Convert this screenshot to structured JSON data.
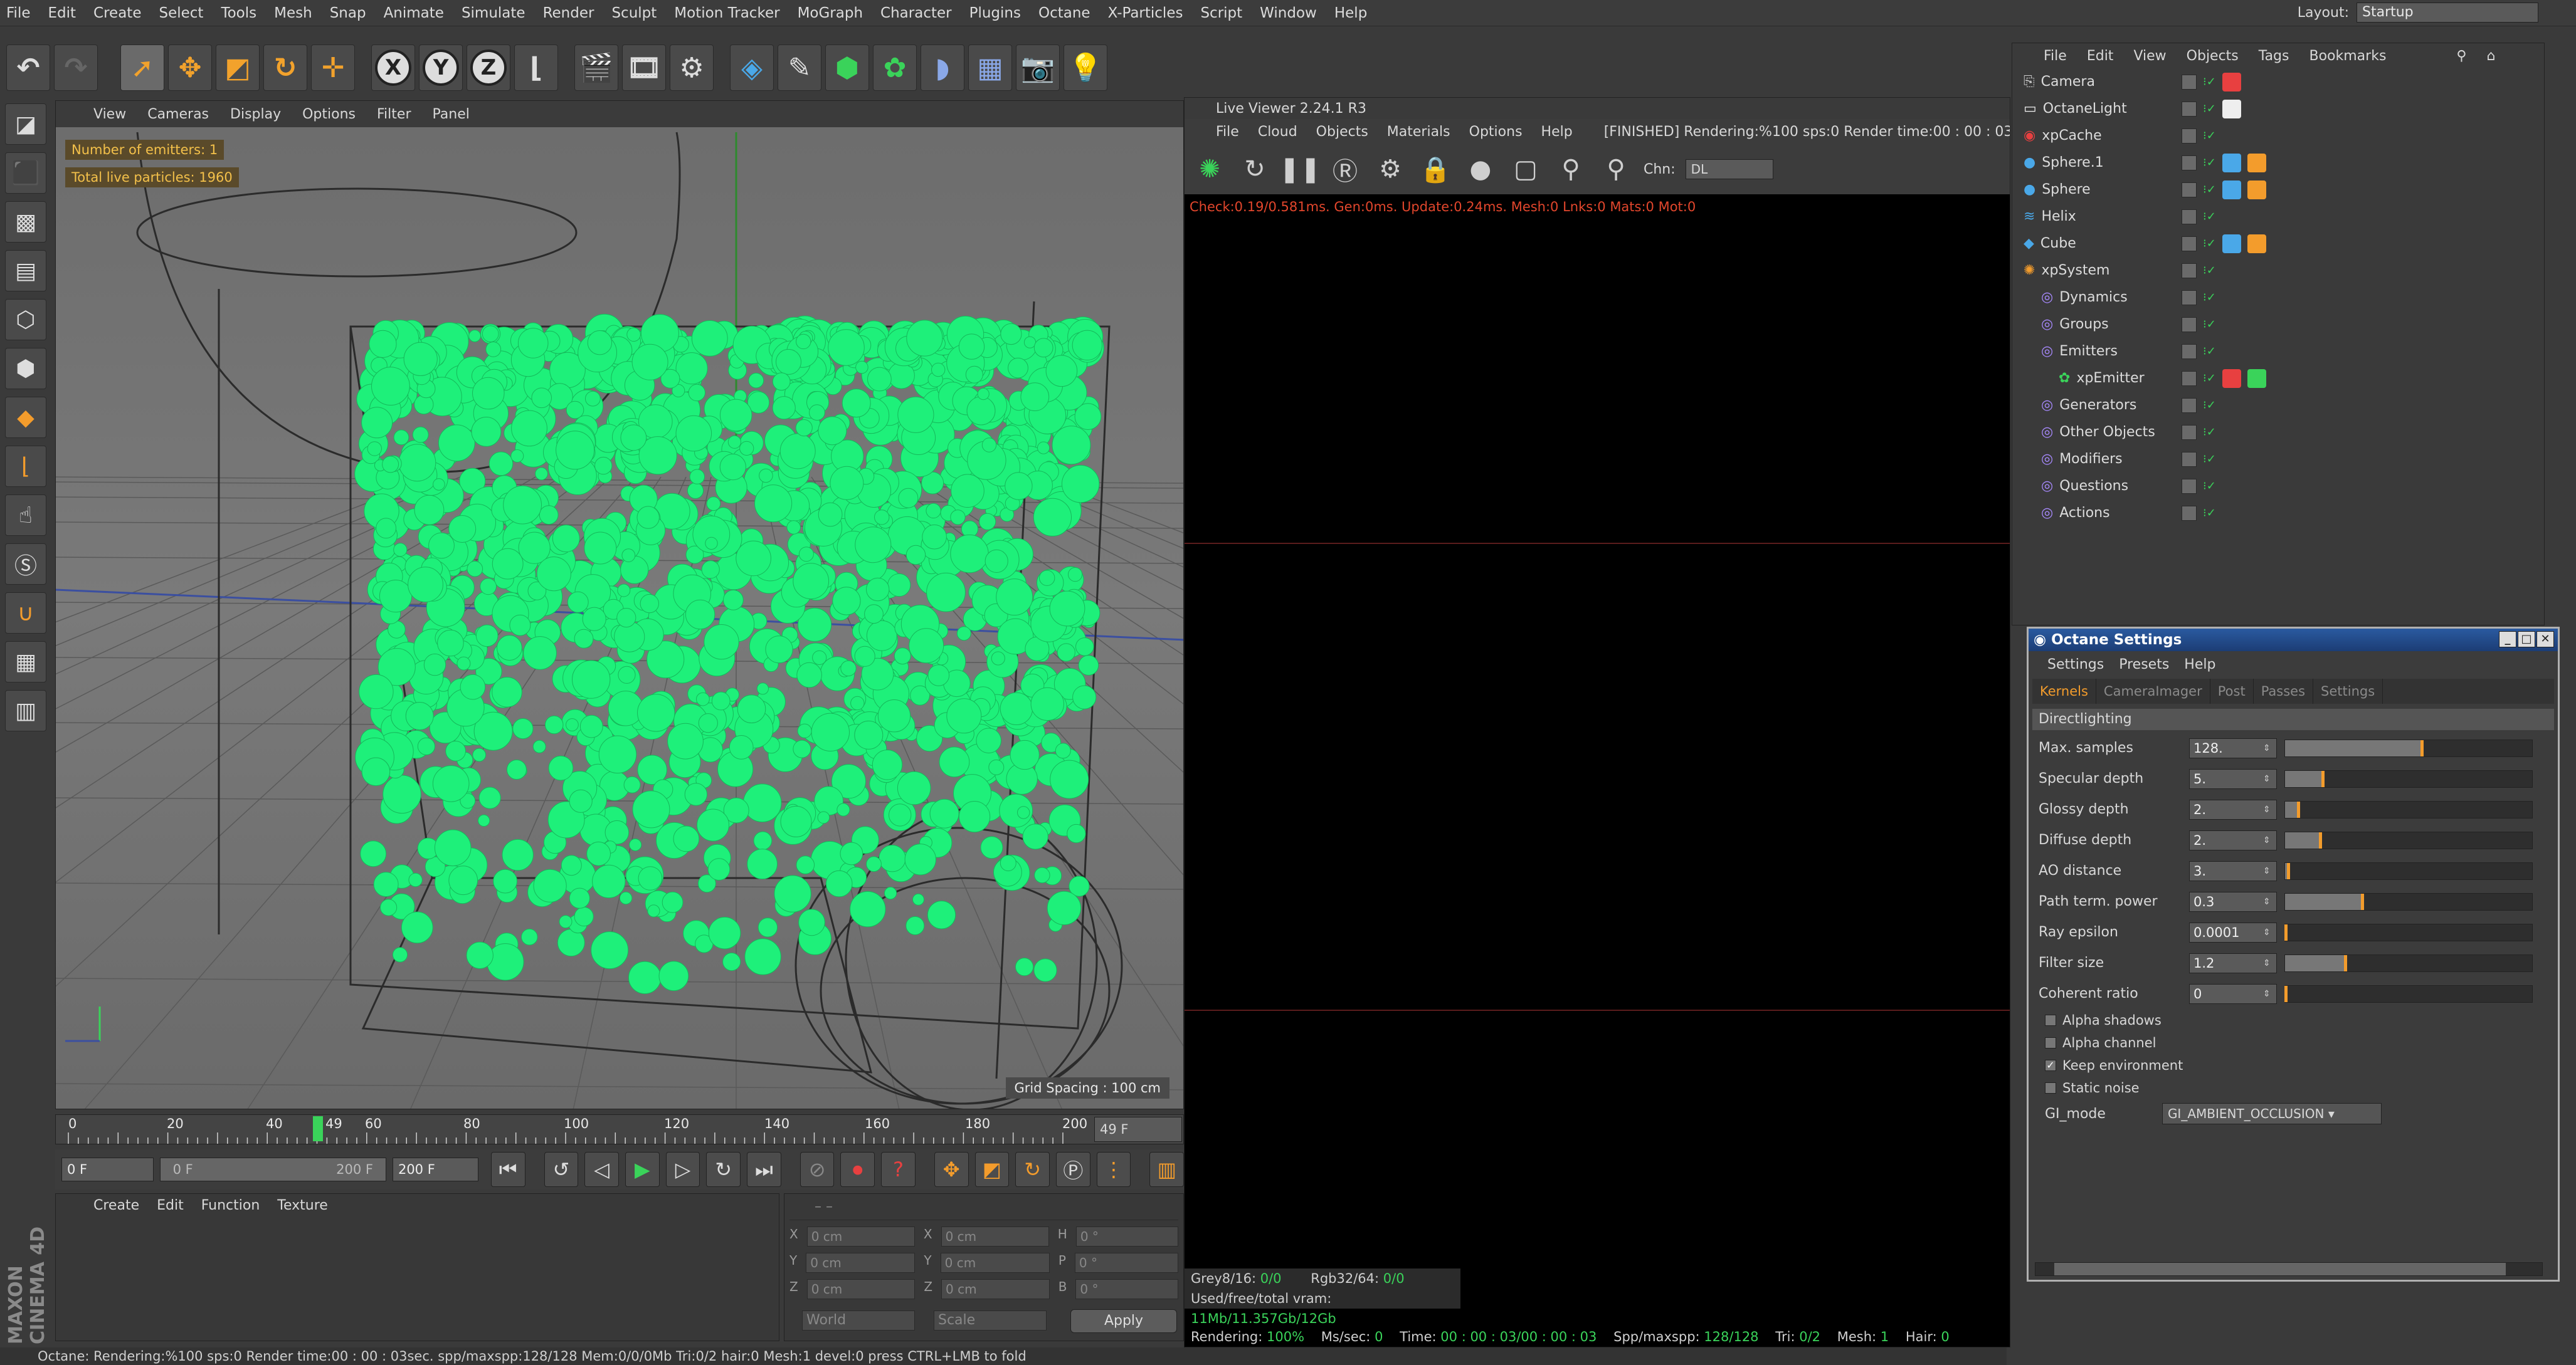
{
  "menubar": {
    "items": [
      "File",
      "Edit",
      "Create",
      "Select",
      "Tools",
      "Mesh",
      "Snap",
      "Animate",
      "Simulate",
      "Render",
      "Sculpt",
      "Motion Tracker",
      "MoGraph",
      "Character",
      "Plugins",
      "Octane",
      "X-Particles",
      "Script",
      "Window",
      "Help"
    ],
    "layout_label": "Layout:",
    "layout_value": "Startup"
  },
  "toolbar": {
    "icons": [
      "undo-icon",
      "redo-icon",
      "live-select-icon",
      "move-icon",
      "scale-icon",
      "rotate-icon",
      "recent-tool-icon",
      "x-axis-icon",
      "y-axis-icon",
      "z-axis-icon",
      "coordinate-system-icon",
      "render-view-icon",
      "render-picture-viewer-icon",
      "render-settings-icon",
      "cube-primitive-icon",
      "pen-spline-icon",
      "subdivision-icon",
      "array-icon",
      "deformer-icon",
      "floor-icon",
      "camera-icon",
      "light-icon"
    ],
    "x": "X",
    "y": "Y",
    "z": "Z"
  },
  "viewport": {
    "menu": [
      "View",
      "Cameras",
      "Display",
      "Options",
      "Filter",
      "Panel"
    ],
    "hud_emitters": "Number of emitters: 1",
    "hud_particles": "Total live particles: 1960",
    "grid_spacing": "Grid Spacing : 100 cm",
    "particle_color": "#1ef07a"
  },
  "timeline": {
    "ticks": [
      "0",
      "20",
      "40",
      "49",
      "60",
      "80",
      "100",
      "120",
      "140",
      "160",
      "180",
      "200"
    ],
    "current_frame": "49 F",
    "start": "0 F",
    "range_start": "0 F",
    "range_end": "200 F",
    "end": "200 F"
  },
  "material_panel": {
    "menu": [
      "Create",
      "Edit",
      "Function",
      "Texture"
    ]
  },
  "coordinates": {
    "rows": [
      {
        "a": "X",
        "av": "0 cm",
        "b": "X",
        "bv": "0 cm",
        "c": "H",
        "cv": "0 °"
      },
      {
        "a": "Y",
        "av": "0 cm",
        "b": "Y",
        "bv": "0 cm",
        "c": "P",
        "cv": "0 °"
      },
      {
        "a": "Z",
        "av": "0 cm",
        "b": "Z",
        "bv": "0 cm",
        "c": "B",
        "cv": "0 °"
      }
    ],
    "world": "World",
    "scale": "Scale",
    "apply": "Apply"
  },
  "brand": "MAXON CINEMA 4D",
  "status": "Octane: Rendering:%100 sps:0 Render time:00 : 00 : 03sec. spp/maxspp:128/128 Mem:0/0/0Mb Tri:0/2 hair:0 Mesh:1 devel:0    press CTRL+LMB to fold",
  "live_viewer": {
    "title": "Live Viewer 2.24.1 R3",
    "menu": [
      "File",
      "Cloud",
      "Objects",
      "Materials",
      "Options",
      "Help"
    ],
    "render_status": "[FINISHED] Rendering:%100 sps:0 Render time:00 : 00 : 03",
    "chn_label": "Chn:",
    "chn_value": "DL",
    "check_line": "Check:0.19/0.581ms. Gen:0ms. Update:0.24ms. Mesh:0 Lnks:0 Mats:0 Mot:0",
    "grey_label": "Grey8/16:",
    "grey_value": "0/0",
    "rgb_label": "Rgb32/64:",
    "rgb_value": "0/0",
    "vram_label": "Used/free/total vram:",
    "vram_value": "11Mb/11.357Gb/12Gb",
    "render_label": "Rendering:",
    "render_value": "100%",
    "ms_label": "Ms/sec:",
    "ms_value": "0",
    "time_label": "Time:",
    "time_value": "00 : 00 : 03/00 : 00 : 03",
    "spp_label": "Spp/maxspp:",
    "spp_value": "128/128",
    "tri_label": "Tri:",
    "tri_value": "0/2",
    "mesh_label": "Mesh:",
    "mesh_value": "1",
    "hair_label": "Hair:",
    "hair_value": "0"
  },
  "object_manager": {
    "menu": [
      "File",
      "Edit",
      "View",
      "Objects",
      "Tags",
      "Bookmarks"
    ],
    "items": [
      {
        "name": "Camera",
        "icon": "camera-object-icon",
        "indent": 0
      },
      {
        "name": "OctaneLight",
        "icon": "light-object-icon",
        "indent": 0
      },
      {
        "name": "xpCache",
        "icon": "xp-cache-icon",
        "indent": 0
      },
      {
        "name": "Sphere.1",
        "icon": "sphere-object-icon",
        "indent": 0
      },
      {
        "name": "Sphere",
        "icon": "sphere-object-icon",
        "indent": 0
      },
      {
        "name": "Helix",
        "icon": "helix-object-icon",
        "indent": 0
      },
      {
        "name": "Cube",
        "icon": "cube-object-icon",
        "indent": 0
      },
      {
        "name": "xpSystem",
        "icon": "xp-system-icon",
        "indent": 0
      },
      {
        "name": "Dynamics",
        "icon": "folder-icon",
        "indent": 1
      },
      {
        "name": "Groups",
        "icon": "folder-icon",
        "indent": 1
      },
      {
        "name": "Emitters",
        "icon": "folder-icon",
        "indent": 1
      },
      {
        "name": "xpEmitter",
        "icon": "xp-emitter-icon",
        "indent": 2
      },
      {
        "name": "Generators",
        "icon": "folder-icon",
        "indent": 1
      },
      {
        "name": "Other Objects",
        "icon": "folder-icon",
        "indent": 1
      },
      {
        "name": "Modifiers",
        "icon": "folder-icon",
        "indent": 1
      },
      {
        "name": "Questions",
        "icon": "folder-icon",
        "indent": 1
      },
      {
        "name": "Actions",
        "icon": "folder-icon",
        "indent": 1
      }
    ]
  },
  "octane_settings": {
    "title": "Octane Settings",
    "menu": [
      "Settings",
      "Presets",
      "Help"
    ],
    "tabs": [
      "Kernels",
      "CameraImager",
      "Post",
      "Passes",
      "Settings"
    ],
    "kernel": "Directlighting",
    "params": [
      {
        "label": "Max. samples",
        "value": "128.",
        "level": 0.56
      },
      {
        "label": "Specular depth",
        "value": "5.",
        "level": 0.16
      },
      {
        "label": "Glossy depth",
        "value": "2.",
        "level": 0.06
      },
      {
        "label": "Diffuse depth",
        "value": "2.",
        "level": 0.15
      },
      {
        "label": "AO distance",
        "value": "3.",
        "level": 0.02
      },
      {
        "label": "Path term. power",
        "value": "0.3",
        "level": 0.32
      },
      {
        "label": "Ray epsilon",
        "value": "0.0001",
        "level": 0.0
      },
      {
        "label": "Filter size",
        "value": "1.2",
        "level": 0.25
      },
      {
        "label": "Coherent ratio",
        "value": "0",
        "level": 0.0
      }
    ],
    "checks": [
      {
        "label": "Alpha shadows",
        "checked": false
      },
      {
        "label": "Alpha channel",
        "checked": false
      },
      {
        "label": "Keep environment",
        "checked": true
      },
      {
        "label": "Static noise",
        "checked": false
      }
    ],
    "gi_label": "GI_mode",
    "gi_value": "GI_AMBIENT_OCCLUSION"
  }
}
